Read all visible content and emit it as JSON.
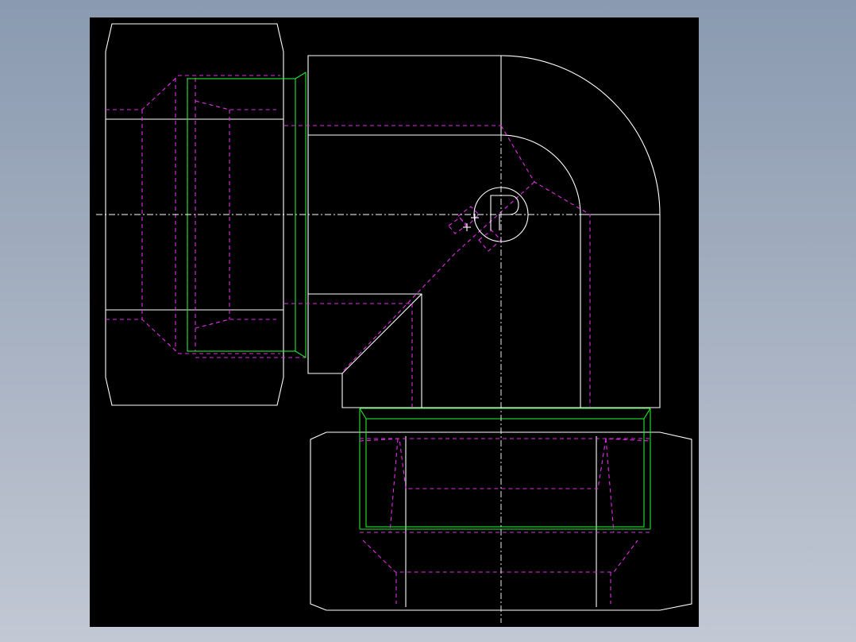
{
  "drawing": {
    "part": "elbow-fitting",
    "view": "front",
    "background_color": "#000000",
    "window_color": "#8a9ab0",
    "layers": {
      "outline": "#ffffff",
      "hidden": "#e22ee6",
      "thread": "#22e82b",
      "centerline": "#ffffff"
    },
    "logo_letter": "P"
  }
}
